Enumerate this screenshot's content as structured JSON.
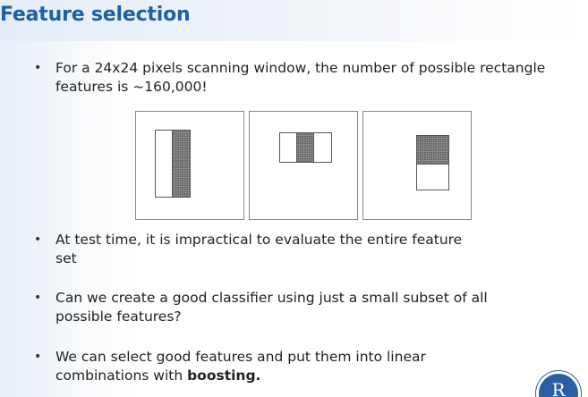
{
  "slide": {
    "title": "Feature selection",
    "bullets": [
      {
        "text": "For a 24x24 pixels scanning window, the number of possible rectangle features is ~160,000!"
      },
      {
        "text": "At test time, it is impractical to evaluate the entire feature set"
      },
      {
        "text": "Can we create a good classifier using just a small subset of all possible features?"
      },
      {
        "text_before": "We can select good features and put them into linear combinations with ",
        "bold_text": "boosting."
      }
    ],
    "bullet_glyph": "•",
    "figures": [
      {
        "name": "two-rectangle-horizontal-feature"
      },
      {
        "name": "three-rectangle-feature"
      },
      {
        "name": "two-rectangle-vertical-feature"
      }
    ],
    "logo_letter": "R"
  },
  "colors": {
    "title": "#1f5fa3",
    "text": "#222222",
    "feature_dark": "#8c8c8c",
    "logo": "#2a5ea5"
  }
}
